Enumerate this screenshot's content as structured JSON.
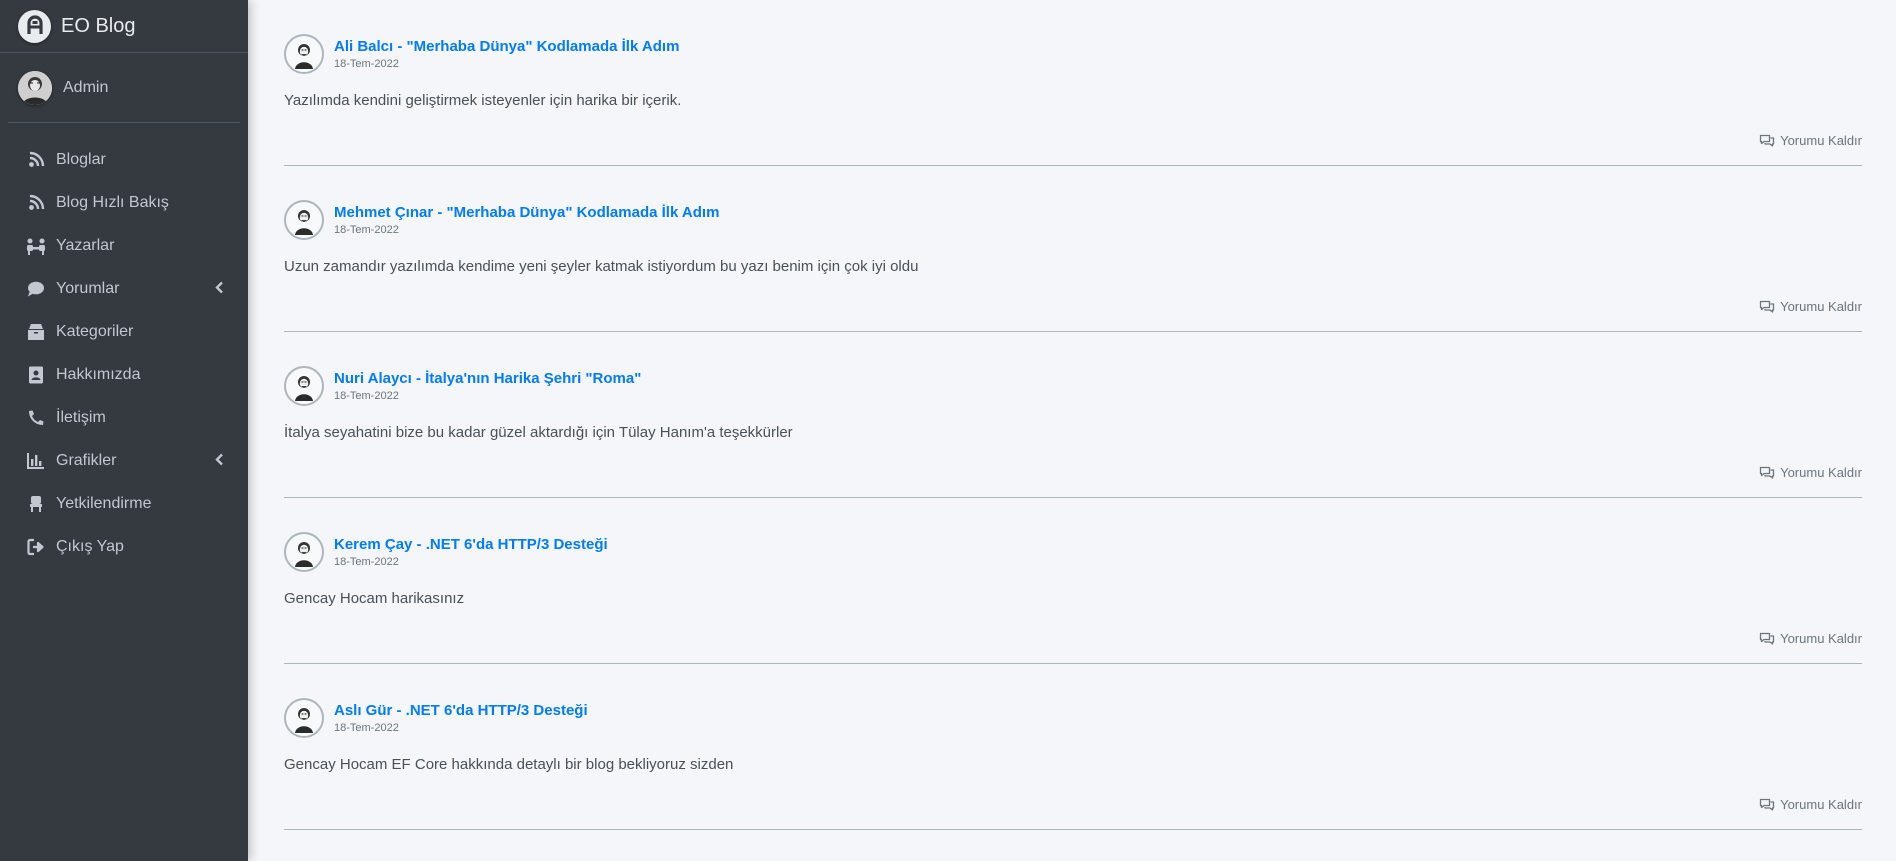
{
  "brand": {
    "name": "EO Blog"
  },
  "user": {
    "name": "Admin"
  },
  "nav": [
    {
      "label": "Bloglar",
      "icon": "blog-icon",
      "has_arrow": false
    },
    {
      "label": "Blog Hızlı Bakış",
      "icon": "blog-icon",
      "has_arrow": false
    },
    {
      "label": "Yazarlar",
      "icon": "users-icon",
      "has_arrow": false
    },
    {
      "label": "Yorumlar",
      "icon": "comment-icon",
      "has_arrow": true
    },
    {
      "label": "Kategoriler",
      "icon": "box-icon",
      "has_arrow": false
    },
    {
      "label": "Hakkımızda",
      "icon": "address-card-icon",
      "has_arrow": false
    },
    {
      "label": "İletişim",
      "icon": "phone-icon",
      "has_arrow": false
    },
    {
      "label": "Grafikler",
      "icon": "chart-bar-icon",
      "has_arrow": true
    },
    {
      "label": "Yetkilendirme",
      "icon": "chair-icon",
      "has_arrow": false
    },
    {
      "label": "Çıkış Yap",
      "icon": "sign-out-icon",
      "has_arrow": false
    }
  ],
  "comments": [
    {
      "title": "Ali Balcı - \"Merhaba Dünya\" Kodlamada İlk Adım",
      "date": "18-Tem-2022",
      "text": "Yazılımda kendini geliştirmek isteyenler için harika bir içerik.",
      "action": "Yorumu Kaldır"
    },
    {
      "title": "Mehmet Çınar - \"Merhaba Dünya\" Kodlamada İlk Adım",
      "date": "18-Tem-2022",
      "text": "Uzun zamandır yazılımda kendime yeni şeyler katmak istiyordum bu yazı benim için çok iyi oldu",
      "action": "Yorumu Kaldır"
    },
    {
      "title": "Nuri Alaycı - İtalya'nın Harika Şehri \"Roma\"",
      "date": "18-Tem-2022",
      "text": "İtalya seyahatini bize bu kadar güzel aktardığı için Tülay Hanım'a teşekkürler",
      "action": "Yorumu Kaldır"
    },
    {
      "title": "Kerem Çay - .NET 6'da HTTP/3 Desteği",
      "date": "18-Tem-2022",
      "text": "Gencay Hocam harikasınız",
      "action": "Yorumu Kaldır"
    },
    {
      "title": "Aslı Gür - .NET 6'da HTTP/3 Desteği",
      "date": "18-Tem-2022",
      "text": "Gencay Hocam EF Core hakkında detaylı bir blog bekliyoruz sizden",
      "action": "Yorumu Kaldır"
    }
  ],
  "colors": {
    "sidebar": "#343a40",
    "link": "#007bff",
    "background": "#f4f6f9"
  }
}
